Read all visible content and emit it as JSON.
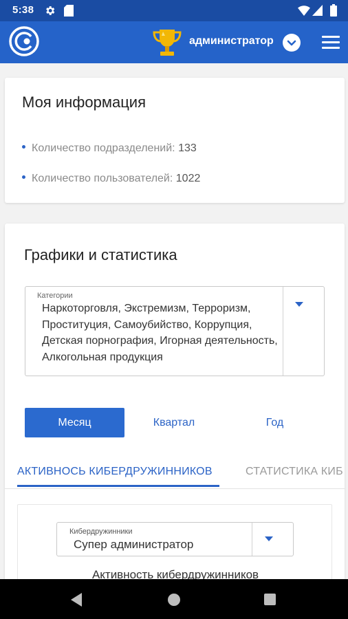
{
  "status_bar": {
    "time": "5:38",
    "icons": [
      "gear-icon",
      "sd-card-icon",
      "wifi-icon",
      "signal-icon",
      "battery-icon"
    ]
  },
  "app_bar": {
    "username": "администратор",
    "icons": [
      "app-logo-icon",
      "trophy-icon",
      "chevron-down-icon",
      "hamburger-menu-icon"
    ],
    "colors": {
      "status_bar": "#1a4ca3",
      "app_bar": "#2563c9",
      "trophy": "#f2b705"
    }
  },
  "my_info": {
    "title": "Моя информация",
    "items": [
      {
        "label": "Количество подразделений:",
        "value": "133"
      },
      {
        "label": "Количество пользователей:",
        "value": "1022"
      }
    ]
  },
  "stats": {
    "title": "Графики и статистика",
    "categories_select": {
      "label": "Категории",
      "value": "Наркоторговля, Экстремизм, Терроризм, Проституция, Самоубийство, Коррупция, Детская порнография, Игорная деятельность, Алкогольная продукция"
    },
    "periods": [
      "Месяц",
      "Квартал",
      "Год"
    ],
    "selected_period": "Месяц",
    "tabs": [
      "АКТИВНОСЬ КИБЕРДРУЖИННИКОВ",
      "СТАТИСТИКА КИБ"
    ],
    "selected_tab": "АКТИВНОСЬ КИБЕРДРУЖИННИКОВ",
    "volunteers_select": {
      "label": "Кибердружинники",
      "value": "Супер администратор"
    },
    "chart_heading": "Активность кибердружинников",
    "accent_color": "#2b63c6"
  },
  "nav_bar": {
    "icons": [
      "back-icon",
      "home-icon",
      "recents-icon"
    ]
  }
}
